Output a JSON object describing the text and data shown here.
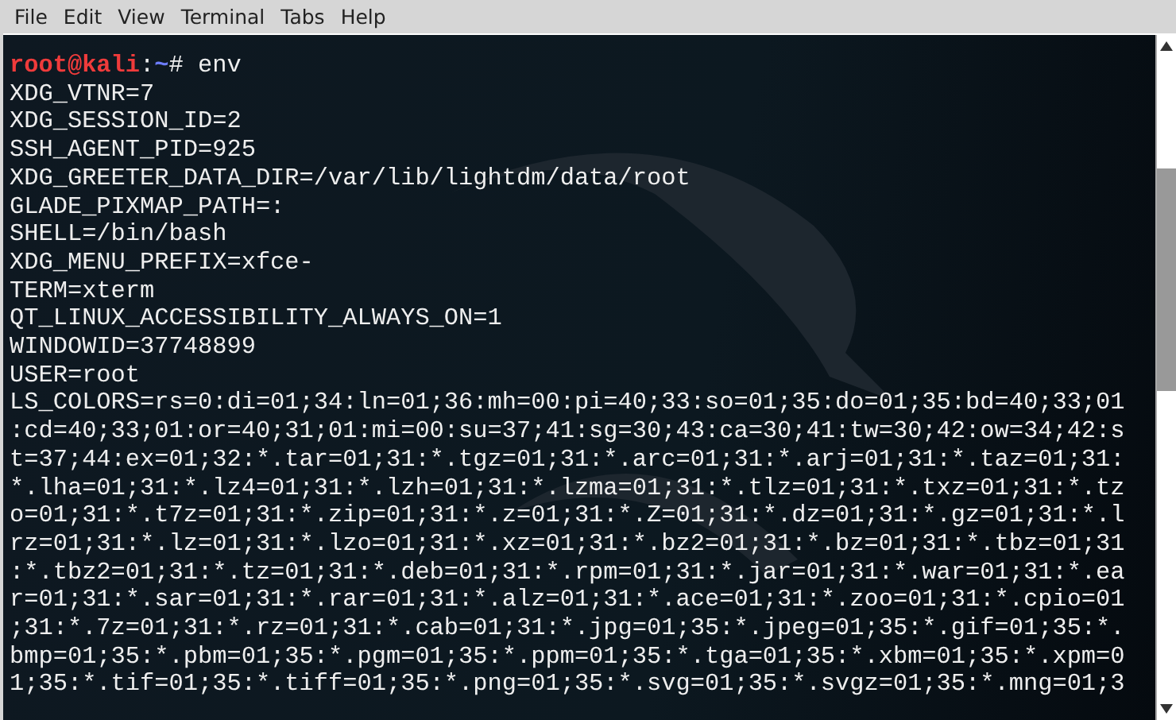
{
  "menu": [
    "File",
    "Edit",
    "View",
    "Terminal",
    "Tabs",
    "Help"
  ],
  "terminal": {
    "prompt": {
      "user_host": "root@kali",
      "separator": ":",
      "path": "~",
      "command": "# env"
    },
    "output": [
      "XDG_VTNR=7",
      "XDG_SESSION_ID=2",
      "SSH_AGENT_PID=925",
      "XDG_GREETER_DATA_DIR=/var/lib/lightdm/data/root",
      "GLADE_PIXMAP_PATH=:",
      "SHELL=/bin/bash",
      "XDG_MENU_PREFIX=xfce-",
      "TERM=xterm",
      "QT_LINUX_ACCESSIBILITY_ALWAYS_ON=1",
      "WINDOWID=37748899",
      "USER=root",
      "LS_COLORS=rs=0:di=01;34:ln=01;36:mh=00:pi=40;33:so=01;35:do=01;35:bd=40;33;01",
      ":cd=40;33;01:or=40;31;01:mi=00:su=37;41:sg=30;43:ca=30;41:tw=30;42:ow=34;42:s",
      "t=37;44:ex=01;32:*.tar=01;31:*.tgz=01;31:*.arc=01;31:*.arj=01;31:*.taz=01;31:",
      "*.lha=01;31:*.lz4=01;31:*.lzh=01;31:*.lzma=01;31:*.tlz=01;31:*.txz=01;31:*.tz",
      "o=01;31:*.t7z=01;31:*.zip=01;31:*.z=01;31:*.Z=01;31:*.dz=01;31:*.gz=01;31:*.l",
      "rz=01;31:*.lz=01;31:*.lzo=01;31:*.xz=01;31:*.bz2=01;31:*.bz=01;31:*.tbz=01;31",
      ":*.tbz2=01;31:*.tz=01;31:*.deb=01;31:*.rpm=01;31:*.jar=01;31:*.war=01;31:*.ea",
      "r=01;31:*.sar=01;31:*.rar=01;31:*.alz=01;31:*.ace=01;31:*.zoo=01;31:*.cpio=01",
      ";31:*.7z=01;31:*.rz=01;31:*.cab=01;31:*.jpg=01;35:*.jpeg=01;35:*.gif=01;35:*.",
      "bmp=01;35:*.pbm=01;35:*.pgm=01;35:*.ppm=01;35:*.tga=01;35:*.xbm=01;35:*.xpm=0",
      "1;35:*.tif=01;35:*.tiff=01;35:*.png=01;35:*.svg=01;35:*.svgz=01;35:*.mng=01;3"
    ]
  }
}
